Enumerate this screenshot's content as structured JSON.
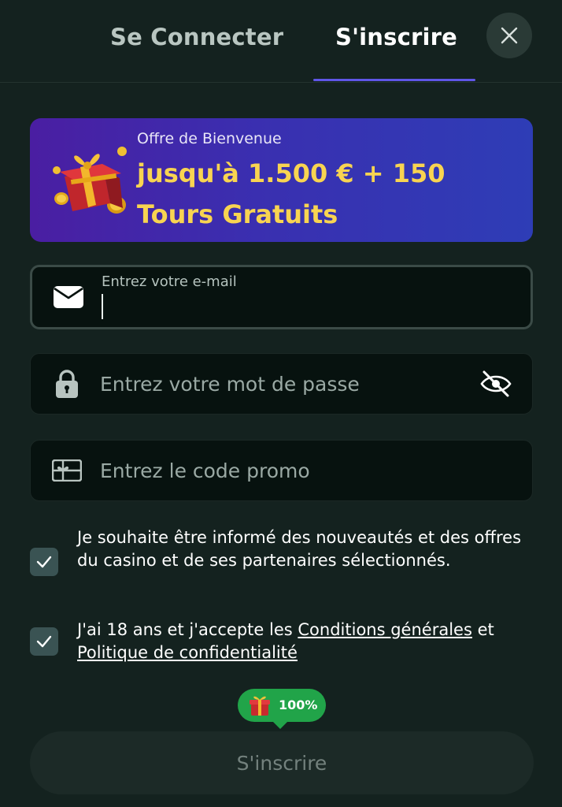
{
  "tabs": {
    "login": "Se Connecter",
    "register": "S'inscrire"
  },
  "banner": {
    "subtitle": "Offre de Bienvenue",
    "title_line1": "jusqu'à 1.500 € + 150",
    "title_line2": "Tours Gratuits"
  },
  "email": {
    "label": "Entrez votre e-mail",
    "value": ""
  },
  "password": {
    "placeholder": "Entrez votre mot de passe"
  },
  "promo": {
    "placeholder": "Entrez le code promo"
  },
  "checkboxes": [
    {
      "checked": true,
      "text": "Je souhaite être informé des nouveautés et des offres du casino et de ses partenaires sélectionnés."
    },
    {
      "checked": true,
      "text_before": "J'ai 18 ans et j'accepte les ",
      "link1": "Conditions générales",
      "text_middle": " et ",
      "link2": "Politique de confidentialité"
    }
  ],
  "progress": {
    "label": "100%",
    "value": 1.0
  },
  "submit": {
    "label": "S'inscrire"
  },
  "icons": {
    "close": "close-icon",
    "email": "envelope-icon",
    "password": "lock-icon",
    "password_toggle": "eye-off-icon",
    "promo": "ticket-icon",
    "check": "checkmark-icon",
    "gift": "gift-icon"
  },
  "colors": {
    "background": "#14221f",
    "accent": "#5f56e6",
    "banner_gold": "#f8d451",
    "progress_green": "#21a449",
    "checkbox": "#3a5353"
  }
}
